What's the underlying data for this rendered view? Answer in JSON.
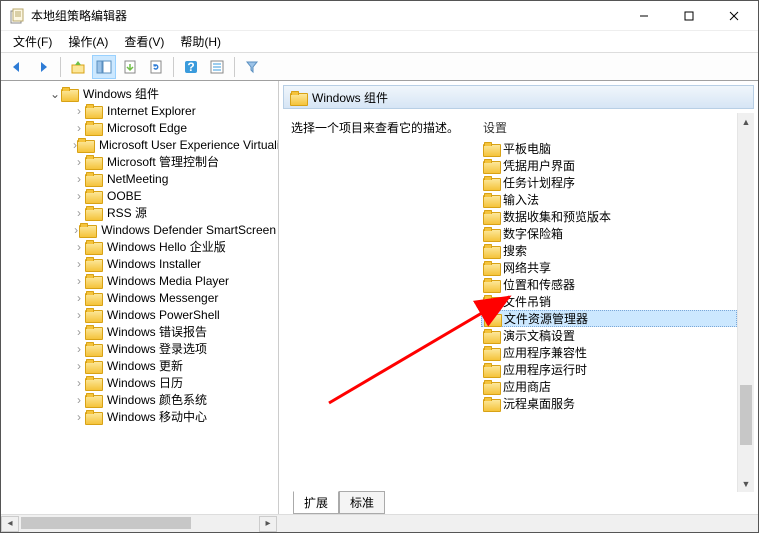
{
  "window": {
    "title": "本地组策略编辑器"
  },
  "menu": {
    "file": "文件(F)",
    "action": "操作(A)",
    "view": "查看(V)",
    "help": "帮助(H)"
  },
  "tree": {
    "root_expanded_label": "Windows 组件",
    "items": [
      "Internet Explorer",
      "Microsoft Edge",
      "Microsoft User Experience Virtualization",
      "Microsoft 管理控制台",
      "NetMeeting",
      "OOBE",
      "RSS 源",
      "Windows Defender SmartScreen",
      "Windows Hello 企业版",
      "Windows Installer",
      "Windows Media Player",
      "Windows Messenger",
      "Windows PowerShell",
      "Windows 错误报告",
      "Windows 登录选项",
      "Windows 更新",
      "Windows 日历",
      "Windows 颜色系统",
      "Windows 移动中心"
    ]
  },
  "right": {
    "header": "Windows 组件",
    "description": "选择一个项目来查看它的描述。",
    "column_header": "设置",
    "items": [
      "平板电脑",
      "凭据用户界面",
      "任务计划程序",
      "输入法",
      "数据收集和预览版本",
      "数字保险箱",
      "搜索",
      "网络共享",
      "位置和传感器",
      "文件吊销",
      "文件资源管理器",
      "演示文稿设置",
      "应用程序兼容性",
      "应用程序运行时",
      "应用商店",
      "沅程桌面服务"
    ],
    "selected_index": 10
  },
  "tabs": {
    "extend": "扩展",
    "standard": "标准"
  }
}
